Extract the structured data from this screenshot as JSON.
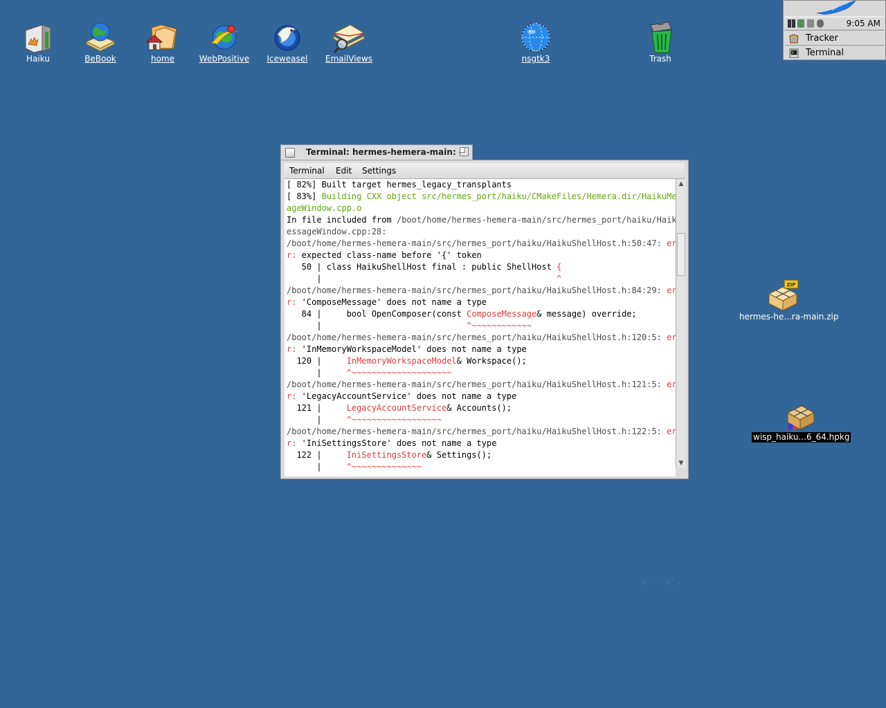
{
  "desktop_icons": [
    {
      "label": "Haiku",
      "icon": "haiku-volume-icon"
    },
    {
      "label": "BeBook",
      "icon": "bebook-icon"
    },
    {
      "label": "home",
      "icon": "home-folder-icon"
    },
    {
      "label": "WebPositive",
      "icon": "webpositive-icon"
    },
    {
      "label": "Iceweasel",
      "icon": "iceweasel-icon"
    },
    {
      "label": "EmailViews",
      "icon": "emailviews-icon"
    },
    {
      "label": "nsgtk3",
      "icon": "nsgtk3-icon"
    },
    {
      "label": "Trash",
      "icon": "trash-icon"
    },
    {
      "label": "hermes-he...ra-main.zip",
      "icon": "zip-package-icon"
    },
    {
      "label": "wisp_haiku...6_64.hpkg",
      "icon": "hpkg-package-icon"
    }
  ],
  "deskbar": {
    "clock": "9:05 AM",
    "items": [
      {
        "label": "Tracker",
        "icon": "tracker-icon"
      },
      {
        "label": "Terminal",
        "icon": "terminal-icon"
      }
    ]
  },
  "terminal": {
    "title": "Terminal: hermes-hemera-main: --",
    "menu": [
      "Terminal",
      "Edit",
      "Settings"
    ],
    "lines": [
      [
        {
          "t": "[ 82%] Built target hermes_legacy_transplants",
          "c": ""
        }
      ],
      [
        {
          "t": "[ 83%] ",
          "c": ""
        },
        {
          "t": "Building CXX object src/hermes_port/haiku/CMakeFiles/Hemera.dir/HaikuMess",
          "c": "green"
        }
      ],
      [
        {
          "t": "ageWindow.cpp.o",
          "c": "green"
        }
      ],
      [
        {
          "t": "In file included from ",
          "c": ""
        },
        {
          "t": "/boot/home/hermes-hemera-main/src/hermes_port/haiku/HaikuM",
          "c": "gray"
        }
      ],
      [
        {
          "t": "essageWindow.cpp:28:",
          "c": "gray"
        }
      ],
      [
        {
          "t": "/boot/home/hermes-hemera-main/src/hermes_port/haiku/HaikuShellHost.h:50:47: ",
          "c": "gray"
        },
        {
          "t": "erro",
          "c": "red"
        }
      ],
      [
        {
          "t": "r:",
          "c": "red"
        },
        {
          "t": " expected class-name before '{' token",
          "c": ""
        }
      ],
      [
        {
          "t": "   50 | class HaikuShellHost final : public ShellHost ",
          "c": ""
        },
        {
          "t": "{",
          "c": "red"
        }
      ],
      [
        {
          "t": "      |                                               ",
          "c": ""
        },
        {
          "t": "^",
          "c": "red"
        }
      ],
      [
        {
          "t": "/boot/home/hermes-hemera-main/src/hermes_port/haiku/HaikuShellHost.h:84:29: ",
          "c": "gray"
        },
        {
          "t": "erro",
          "c": "red"
        }
      ],
      [
        {
          "t": "r:",
          "c": "red"
        },
        {
          "t": " 'ComposeMessage' does not name a type",
          "c": ""
        }
      ],
      [
        {
          "t": "   84 |     bool OpenComposer(const ",
          "c": ""
        },
        {
          "t": "ComposeMessage",
          "c": "red"
        },
        {
          "t": "& message) override;",
          "c": ""
        }
      ],
      [
        {
          "t": "      |                             ",
          "c": ""
        },
        {
          "t": "^~~~~~~~~~~~~",
          "c": "red"
        }
      ],
      [
        {
          "t": "/boot/home/hermes-hemera-main/src/hermes_port/haiku/HaikuShellHost.h:120:5: ",
          "c": "gray"
        },
        {
          "t": "erro",
          "c": "red"
        }
      ],
      [
        {
          "t": "r:",
          "c": "red"
        },
        {
          "t": " 'InMemoryWorkspaceModel' does not name a type",
          "c": ""
        }
      ],
      [
        {
          "t": "  120 |     ",
          "c": ""
        },
        {
          "t": "InMemoryWorkspaceModel",
          "c": "red"
        },
        {
          "t": "& Workspace();",
          "c": ""
        }
      ],
      [
        {
          "t": "      |     ",
          "c": ""
        },
        {
          "t": "^~~~~~~~~~~~~~~~~~~~~",
          "c": "red"
        }
      ],
      [
        {
          "t": "/boot/home/hermes-hemera-main/src/hermes_port/haiku/HaikuShellHost.h:121:5: ",
          "c": "gray"
        },
        {
          "t": "erro",
          "c": "red"
        }
      ],
      [
        {
          "t": "r:",
          "c": "red"
        },
        {
          "t": " 'LegacyAccountService' does not name a type",
          "c": ""
        }
      ],
      [
        {
          "t": "  121 |     ",
          "c": ""
        },
        {
          "t": "LegacyAccountService",
          "c": "red"
        },
        {
          "t": "& Accounts();",
          "c": ""
        }
      ],
      [
        {
          "t": "      |     ",
          "c": ""
        },
        {
          "t": "^~~~~~~~~~~~~~~~~~~",
          "c": "red"
        }
      ],
      [
        {
          "t": "/boot/home/hermes-hemera-main/src/hermes_port/haiku/HaikuShellHost.h:122:5: ",
          "c": "gray"
        },
        {
          "t": "erro",
          "c": "red"
        }
      ],
      [
        {
          "t": "r:",
          "c": "red"
        },
        {
          "t": " 'IniSettingsStore' does not name a type",
          "c": ""
        }
      ],
      [
        {
          "t": "  122 |     ",
          "c": ""
        },
        {
          "t": "IniSettingsStore",
          "c": "red"
        },
        {
          "t": "& Settings();",
          "c": ""
        }
      ],
      [
        {
          "t": "      |     ",
          "c": ""
        },
        {
          "t": "^~~~~~~~~~~~~~~",
          "c": "red"
        }
      ]
    ]
  }
}
